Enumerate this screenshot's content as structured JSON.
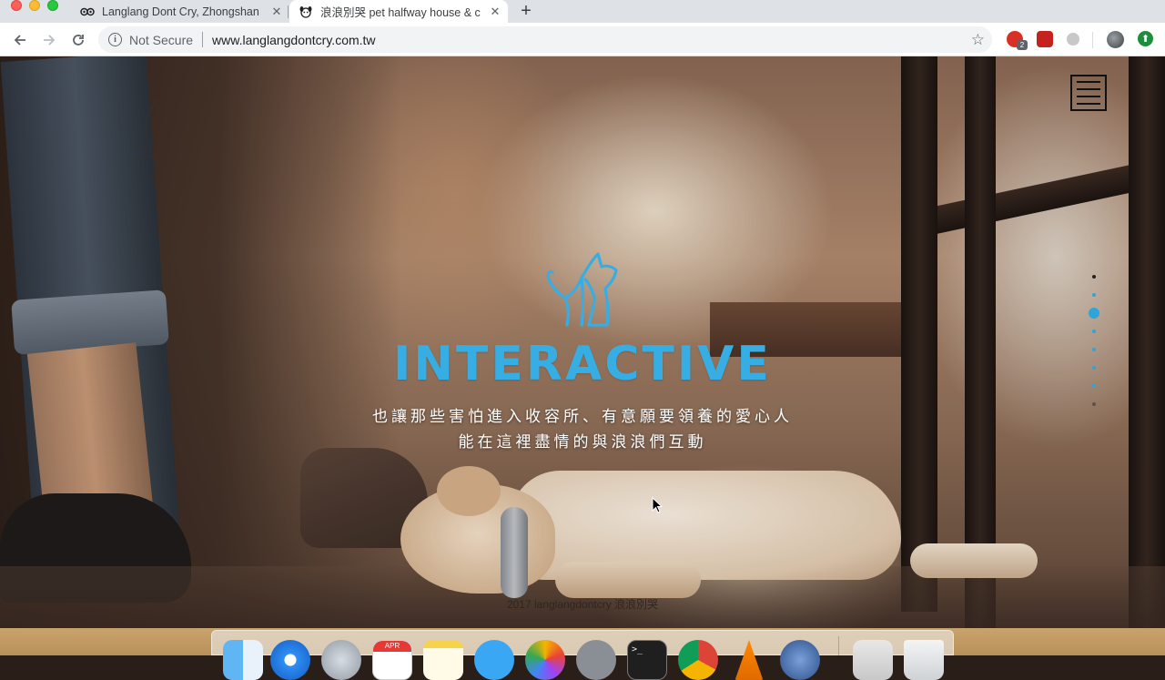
{
  "browser": {
    "tabs": [
      {
        "title": "Langlang Dont Cry, Zhongshan",
        "favicon": "tripadvisor-owl-icon",
        "active": false
      },
      {
        "title": "浪浪別哭 pet halfway house & c",
        "favicon": "dog-face-icon",
        "active": true
      }
    ],
    "new_tab_symbol": "+",
    "close_symbol": "✕",
    "security_label": "Not Secure",
    "url": "www.langlangdontcry.com.tw",
    "extension_badge": "2"
  },
  "page": {
    "headline": "INTERACTIVE",
    "subtitle_line1": "也讓那些害怕進入收容所、有意願要領養的愛心人",
    "subtitle_line2": "能在這裡盡情的與浪浪們互動",
    "footer": "2017 langlangdontcry 浪浪別哭",
    "accent_color": "#37aee3",
    "nav_dot_count": 8,
    "active_nav_dot": 2
  },
  "dock": {
    "calendar_month": "APR",
    "terminal_prompt": ">_"
  }
}
